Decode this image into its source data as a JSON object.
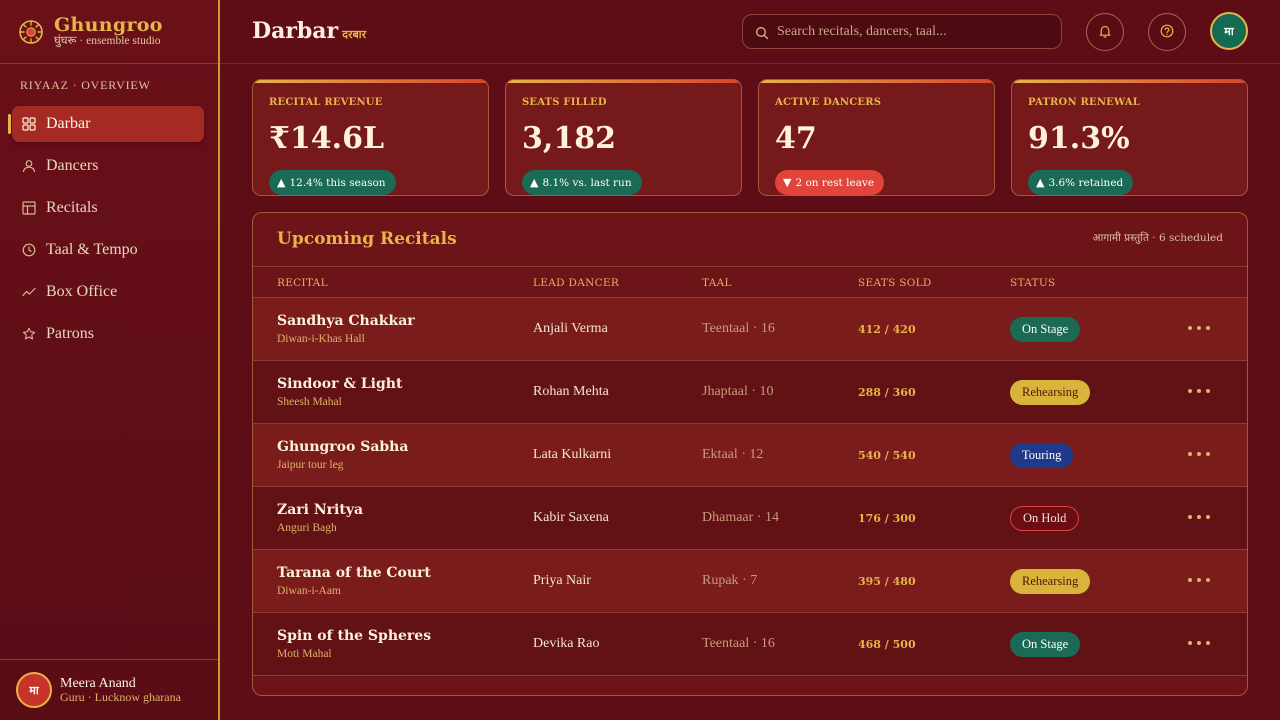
{
  "brand": {
    "name": "Ghungroo",
    "subtitle": "घुंघरू · ensemble studio"
  },
  "sidebar": {
    "section_label": "RIYAAZ · OVERVIEW",
    "items": [
      {
        "label": "Darbar",
        "icon": "grid-icon",
        "active": true
      },
      {
        "label": "Dancers",
        "icon": "user-icon",
        "active": false
      },
      {
        "label": "Recitals",
        "icon": "layout-icon",
        "active": false
      },
      {
        "label": "Taal & Tempo",
        "icon": "clock-icon",
        "active": false
      },
      {
        "label": "Box Office",
        "icon": "trend-line-icon",
        "active": false
      },
      {
        "label": "Patrons",
        "icon": "star-icon",
        "active": false
      }
    ],
    "user": {
      "initials": "मा",
      "name": "Meera Anand",
      "role": "Guru · Lucknow gharana"
    }
  },
  "header": {
    "title": "Darbar",
    "title_sub": "दरबार",
    "search_placeholder": "Search recitals, dancers, taal...",
    "avatar_initials": "मा"
  },
  "stats": [
    {
      "label": "RECITAL REVENUE",
      "value": "₹14.6L",
      "badge": "12.4% this season",
      "trend": "up"
    },
    {
      "label": "SEATS FILLED",
      "value": "3,182",
      "badge": "8.1% vs. last run",
      "trend": "up"
    },
    {
      "label": "ACTIVE DANCERS",
      "value": "47",
      "badge": "2 on rest leave",
      "trend": "down"
    },
    {
      "label": "PATRON RENEWAL",
      "value": "91.3%",
      "badge": "3.6% retained",
      "trend": "up"
    }
  ],
  "recitals": {
    "title": "Upcoming Recitals",
    "meta": "आगामी प्रस्तुति · 6 scheduled",
    "columns": {
      "recital": "RECITAL",
      "lead": "LEAD DANCER",
      "taal": "TAAL",
      "seats": "SEATS SOLD",
      "status": "STATUS"
    },
    "rows": [
      {
        "name": "Sandhya Chakkar",
        "venue": "Diwan-i-Khas Hall",
        "lead": "Anjali Verma",
        "taal": "Teentaal · 16",
        "seats": "412 / 420",
        "status": "On Stage",
        "status_kind": "onstage"
      },
      {
        "name": "Sindoor & Light",
        "venue": "Sheesh Mahal",
        "lead": "Rohan Mehta",
        "taal": "Jhaptaal · 10",
        "seats": "288 / 360",
        "status": "Rehearsing",
        "status_kind": "rehearsing"
      },
      {
        "name": "Ghungroo Sabha",
        "venue": "Jaipur tour leg",
        "lead": "Lata Kulkarni",
        "taal": "Ektaal · 12",
        "seats": "540 / 540",
        "status": "Touring",
        "status_kind": "touring"
      },
      {
        "name": "Zari Nritya",
        "venue": "Anguri Bagh",
        "lead": "Kabir Saxena",
        "taal": "Dhamaar · 14",
        "seats": "176 / 300",
        "status": "On Hold",
        "status_kind": "onhold"
      },
      {
        "name": "Tarana of the Court",
        "venue": "Diwan-i-Aam",
        "lead": "Priya Nair",
        "taal": "Rupak · 7",
        "seats": "395 / 480",
        "status": "Rehearsing",
        "status_kind": "rehearsing"
      },
      {
        "name": "Spin of the Spheres",
        "venue": "Moti Mahal",
        "lead": "Devika Rao",
        "taal": "Teentaal · 16",
        "seats": "468 / 500",
        "status": "On Stage",
        "status_kind": "onstage"
      }
    ]
  }
}
